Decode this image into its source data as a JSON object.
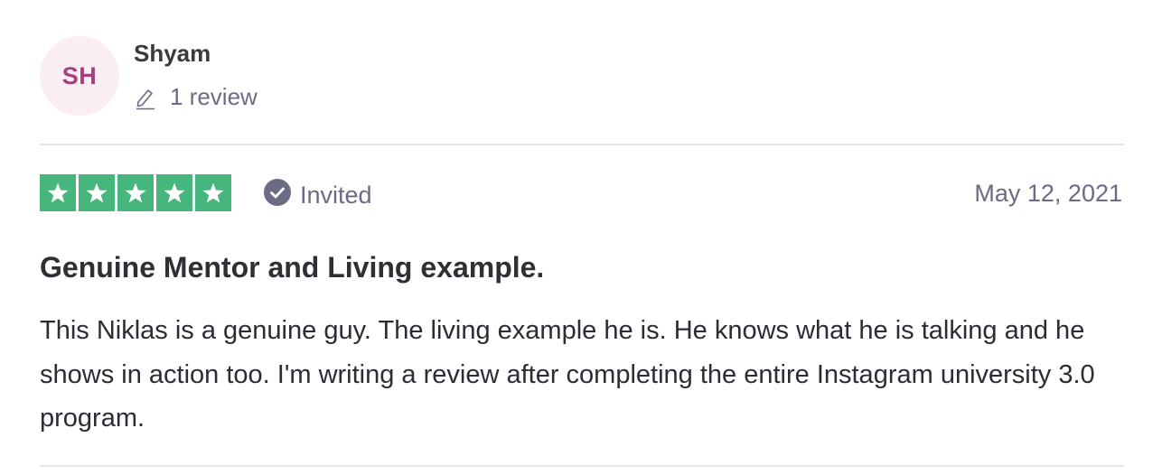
{
  "consumer": {
    "initials": "SH",
    "name": "Shyam",
    "review_count": "1 review",
    "review_icon": "pencil-icon"
  },
  "review": {
    "rating": 5,
    "max_rating": 5,
    "stars_color": "#47b67c",
    "verification_label": "Invited",
    "verification_icon": "check-circle-icon",
    "date": "May 12, 2021",
    "title": "Genuine Mentor and Living example.",
    "body": "This Niklas is a genuine guy. The living example he is. He knows what he is talking and he shows in action too. I'm writing a review after completing the entire Instagram university 3.0 program."
  },
  "colors": {
    "avatar_bg": "#fbeef3",
    "avatar_text": "#a3417c",
    "muted_text": "#6b6b84",
    "divider": "#e5e5ee"
  }
}
